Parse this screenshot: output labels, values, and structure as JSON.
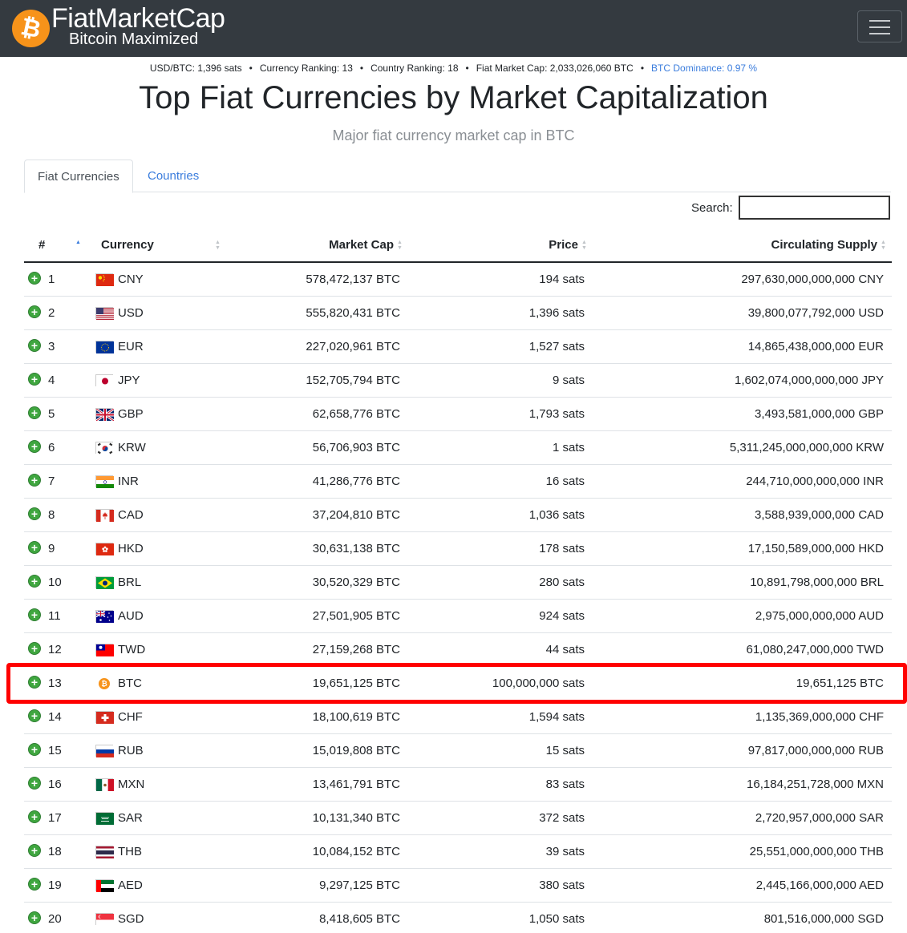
{
  "brand": {
    "title": "FiatMarketCap",
    "subtitle": "Bitcoin Maximized",
    "coin_glyph": "₿"
  },
  "stats": {
    "usd_btc": "USD/BTC: 1,396 sats",
    "currency_ranking": "Currency Ranking: 13",
    "country_ranking": "Country Ranking: 18",
    "fiat_market_cap": "Fiat Market Cap: 2,033,026,060 BTC",
    "btc_dominance": "BTC Dominance: 0.97 %",
    "separator": "•"
  },
  "page": {
    "title": "Top Fiat Currencies by Market Capitalization",
    "subtitle": "Major fiat currency market cap in BTC"
  },
  "tabs": [
    {
      "label": "Fiat Currencies",
      "active": true
    },
    {
      "label": "Countries",
      "active": false
    }
  ],
  "search": {
    "label": "Search:",
    "value": ""
  },
  "table": {
    "headers": {
      "rank": "#",
      "currency": "Currency",
      "market_cap": "Market Cap",
      "price": "Price",
      "supply": "Circulating Supply"
    },
    "rows": [
      {
        "rank": "1",
        "code": "CNY",
        "market_cap": "578,472,137 BTC",
        "price": "194 sats",
        "supply": "297,630,000,000,000 CNY",
        "flag": "cny"
      },
      {
        "rank": "2",
        "code": "USD",
        "market_cap": "555,820,431 BTC",
        "price": "1,396 sats",
        "supply": "39,800,077,792,000 USD",
        "flag": "usd"
      },
      {
        "rank": "3",
        "code": "EUR",
        "market_cap": "227,020,961 BTC",
        "price": "1,527 sats",
        "supply": "14,865,438,000,000 EUR",
        "flag": "eur"
      },
      {
        "rank": "4",
        "code": "JPY",
        "market_cap": "152,705,794 BTC",
        "price": "9 sats",
        "supply": "1,602,074,000,000,000 JPY",
        "flag": "jpy"
      },
      {
        "rank": "5",
        "code": "GBP",
        "market_cap": "62,658,776 BTC",
        "price": "1,793 sats",
        "supply": "3,493,581,000,000 GBP",
        "flag": "gbp"
      },
      {
        "rank": "6",
        "code": "KRW",
        "market_cap": "56,706,903 BTC",
        "price": "1 sats",
        "supply": "5,311,245,000,000,000 KRW",
        "flag": "krw"
      },
      {
        "rank": "7",
        "code": "INR",
        "market_cap": "41,286,776 BTC",
        "price": "16 sats",
        "supply": "244,710,000,000,000 INR",
        "flag": "inr"
      },
      {
        "rank": "8",
        "code": "CAD",
        "market_cap": "37,204,810 BTC",
        "price": "1,036 sats",
        "supply": "3,588,939,000,000 CAD",
        "flag": "cad"
      },
      {
        "rank": "9",
        "code": "HKD",
        "market_cap": "30,631,138 BTC",
        "price": "178 sats",
        "supply": "17,150,589,000,000 HKD",
        "flag": "hkd"
      },
      {
        "rank": "10",
        "code": "BRL",
        "market_cap": "30,520,329 BTC",
        "price": "280 sats",
        "supply": "10,891,798,000,000 BRL",
        "flag": "brl"
      },
      {
        "rank": "11",
        "code": "AUD",
        "market_cap": "27,501,905 BTC",
        "price": "924 sats",
        "supply": "2,975,000,000,000 AUD",
        "flag": "aud"
      },
      {
        "rank": "12",
        "code": "TWD",
        "market_cap": "27,159,268 BTC",
        "price": "44 sats",
        "supply": "61,080,247,000,000 TWD",
        "flag": "twd"
      },
      {
        "rank": "13",
        "code": "BTC",
        "market_cap": "19,651,125 BTC",
        "price": "100,000,000 sats",
        "supply": "19,651,125 BTC",
        "flag": "btc"
      },
      {
        "rank": "14",
        "code": "CHF",
        "market_cap": "18,100,619 BTC",
        "price": "1,594 sats",
        "supply": "1,135,369,000,000 CHF",
        "flag": "chf"
      },
      {
        "rank": "15",
        "code": "RUB",
        "market_cap": "15,019,808 BTC",
        "price": "15 sats",
        "supply": "97,817,000,000,000 RUB",
        "flag": "rub"
      },
      {
        "rank": "16",
        "code": "MXN",
        "market_cap": "13,461,791 BTC",
        "price": "83 sats",
        "supply": "16,184,251,728,000 MXN",
        "flag": "mxn"
      },
      {
        "rank": "17",
        "code": "SAR",
        "market_cap": "10,131,340 BTC",
        "price": "372 sats",
        "supply": "2,720,957,000,000 SAR",
        "flag": "sar"
      },
      {
        "rank": "18",
        "code": "THB",
        "market_cap": "10,084,152 BTC",
        "price": "39 sats",
        "supply": "25,551,000,000,000 THB",
        "flag": "thb"
      },
      {
        "rank": "19",
        "code": "AED",
        "market_cap": "9,297,125 BTC",
        "price": "380 sats",
        "supply": "2,445,166,000,000 AED",
        "flag": "aed"
      },
      {
        "rank": "20",
        "code": "SGD",
        "market_cap": "8,418,605 BTC",
        "price": "1,050 sats",
        "supply": "801,516,000,000 SGD",
        "flag": "sgd"
      }
    ]
  },
  "highlighted_row_rank": "13",
  "colors": {
    "navbar": "#343a40",
    "bitcoin_orange": "#f7931a",
    "link_blue": "#3b7ddd",
    "expand_green": "#3fa63f",
    "highlight_red": "#ff0000"
  }
}
